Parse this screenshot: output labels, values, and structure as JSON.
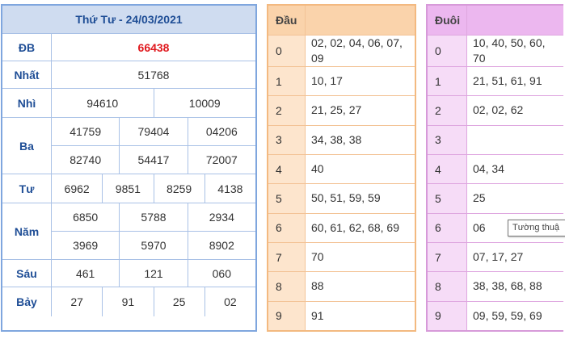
{
  "results": {
    "title": "Thứ Tư - 24/03/2021",
    "rows": [
      {
        "name": "ĐB",
        "lines": [
          [
            "66438"
          ]
        ]
      },
      {
        "name": "Nhất",
        "lines": [
          [
            "51768"
          ]
        ]
      },
      {
        "name": "Nhì",
        "lines": [
          [
            "94610",
            "10009"
          ]
        ]
      },
      {
        "name": "Ba",
        "lines": [
          [
            "41759",
            "79404",
            "04206"
          ],
          [
            "82740",
            "54417",
            "72007"
          ]
        ]
      },
      {
        "name": "Tư",
        "lines": [
          [
            "6962",
            "9851",
            "8259",
            "4138"
          ]
        ]
      },
      {
        "name": "Năm",
        "lines": [
          [
            "6850",
            "5788",
            "2934"
          ],
          [
            "3969",
            "5970",
            "8902"
          ]
        ]
      },
      {
        "name": "Sáu",
        "lines": [
          [
            "461",
            "121",
            "060"
          ]
        ]
      },
      {
        "name": "Bảy",
        "lines": [
          [
            "27",
            "91",
            "25",
            "02"
          ]
        ]
      }
    ]
  },
  "head_table": {
    "header": "Đầu",
    "rows": [
      {
        "key": "0",
        "value": "02, 02, 04, 06, 07, 09"
      },
      {
        "key": "1",
        "value": "10, 17"
      },
      {
        "key": "2",
        "value": "21, 25, 27"
      },
      {
        "key": "3",
        "value": "34, 38, 38"
      },
      {
        "key": "4",
        "value": "40"
      },
      {
        "key": "5",
        "value": "50, 51, 59, 59"
      },
      {
        "key": "6",
        "value": "60, 61, 62, 68, 69"
      },
      {
        "key": "7",
        "value": "70"
      },
      {
        "key": "8",
        "value": "88"
      },
      {
        "key": "9",
        "value": "91"
      }
    ]
  },
  "tail_table": {
    "header": "Đuôi",
    "rows": [
      {
        "key": "0",
        "value": "10, 40, 50, 60, 70"
      },
      {
        "key": "1",
        "value": "21, 51, 61, 91"
      },
      {
        "key": "2",
        "value": "02, 02, 62"
      },
      {
        "key": "3",
        "value": ""
      },
      {
        "key": "4",
        "value": "04, 34"
      },
      {
        "key": "5",
        "value": "25"
      },
      {
        "key": "6",
        "value": "06"
      },
      {
        "key": "7",
        "value": "07, 17, 27"
      },
      {
        "key": "8",
        "value": "38, 38, 68, 88"
      },
      {
        "key": "9",
        "value": "09, 59, 59, 69"
      }
    ]
  },
  "tooltip": {
    "text": "Tường thuậ"
  },
  "colors": {
    "special_prize": "#e0191e",
    "results_title_bg": "#cfdcf0",
    "head_header_bg": "#fad3ab",
    "tail_header_bg": "#ecb7ef"
  }
}
